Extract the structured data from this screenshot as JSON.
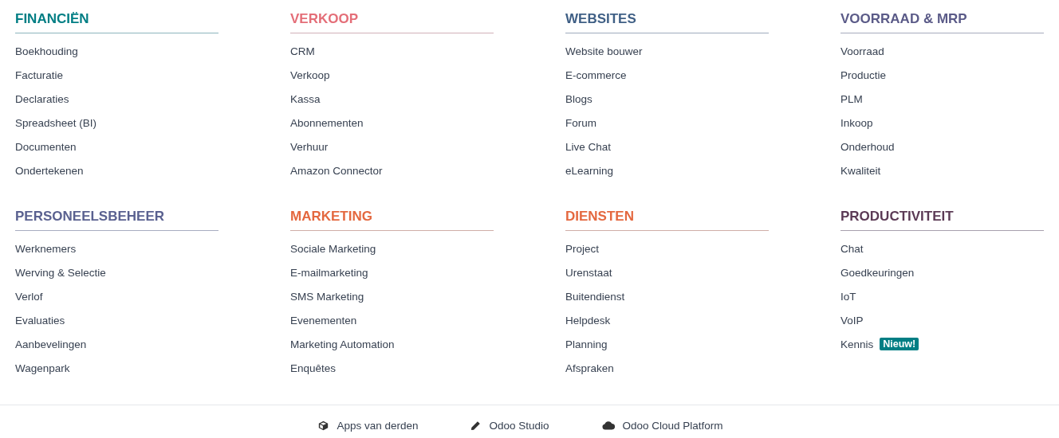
{
  "sections": [
    {
      "title": "FINANCIËN",
      "color": "#017e84",
      "items": [
        {
          "label": "Boekhouding"
        },
        {
          "label": "Facturatie"
        },
        {
          "label": "Declaraties"
        },
        {
          "label": "Spreadsheet (BI)"
        },
        {
          "label": "Documenten"
        },
        {
          "label": "Ondertekenen"
        }
      ]
    },
    {
      "title": "VERKOOP",
      "color": "#e46e78",
      "items": [
        {
          "label": "CRM"
        },
        {
          "label": "Verkoop"
        },
        {
          "label": "Kassa"
        },
        {
          "label": "Abonnementen"
        },
        {
          "label": "Verhuur"
        },
        {
          "label": "Amazon Connector"
        }
      ]
    },
    {
      "title": "WEBSITES",
      "color": "#3f5f85",
      "items": [
        {
          "label": "Website bouwer"
        },
        {
          "label": "E-commerce"
        },
        {
          "label": "Blogs"
        },
        {
          "label": "Forum"
        },
        {
          "label": "Live Chat"
        },
        {
          "label": "eLearning"
        }
      ]
    },
    {
      "title": "VOORRAAD & MRP",
      "color": "#5b5b88",
      "items": [
        {
          "label": "Voorraad"
        },
        {
          "label": "Productie"
        },
        {
          "label": "PLM"
        },
        {
          "label": "Inkoop"
        },
        {
          "label": "Onderhoud"
        },
        {
          "label": "Kwaliteit"
        }
      ]
    },
    {
      "title": "PERSONEELSBEHEER",
      "color": "#5a6190",
      "items": [
        {
          "label": "Werknemers"
        },
        {
          "label": "Werving & Selectie"
        },
        {
          "label": "Verlof"
        },
        {
          "label": "Evaluaties"
        },
        {
          "label": "Aanbevelingen"
        },
        {
          "label": "Wagenpark"
        }
      ]
    },
    {
      "title": "MARKETING",
      "color": "#e4683f",
      "items": [
        {
          "label": "Sociale Marketing"
        },
        {
          "label": "E-mailmarketing"
        },
        {
          "label": "SMS Marketing"
        },
        {
          "label": "Evenementen"
        },
        {
          "label": "Marketing Automation"
        },
        {
          "label": "Enquêtes"
        }
      ]
    },
    {
      "title": "DIENSTEN",
      "color": "#e4683f",
      "items": [
        {
          "label": "Project"
        },
        {
          "label": "Urenstaat"
        },
        {
          "label": "Buitendienst"
        },
        {
          "label": "Helpdesk"
        },
        {
          "label": "Planning"
        },
        {
          "label": "Afspraken"
        }
      ]
    },
    {
      "title": "PRODUCTIVITEIT",
      "color": "#5b3a55",
      "items": [
        {
          "label": "Chat"
        },
        {
          "label": "Goedkeuringen"
        },
        {
          "label": "IoT"
        },
        {
          "label": "VoIP"
        },
        {
          "label": "Kennis",
          "badge": "Nieuw!"
        }
      ]
    }
  ],
  "footer_links": [
    {
      "kind": "cube",
      "label": "Apps van derden"
    },
    {
      "kind": "pencil",
      "label": "Odoo Studio"
    },
    {
      "kind": "cloud",
      "label": "Odoo Cloud Platform"
    }
  ]
}
